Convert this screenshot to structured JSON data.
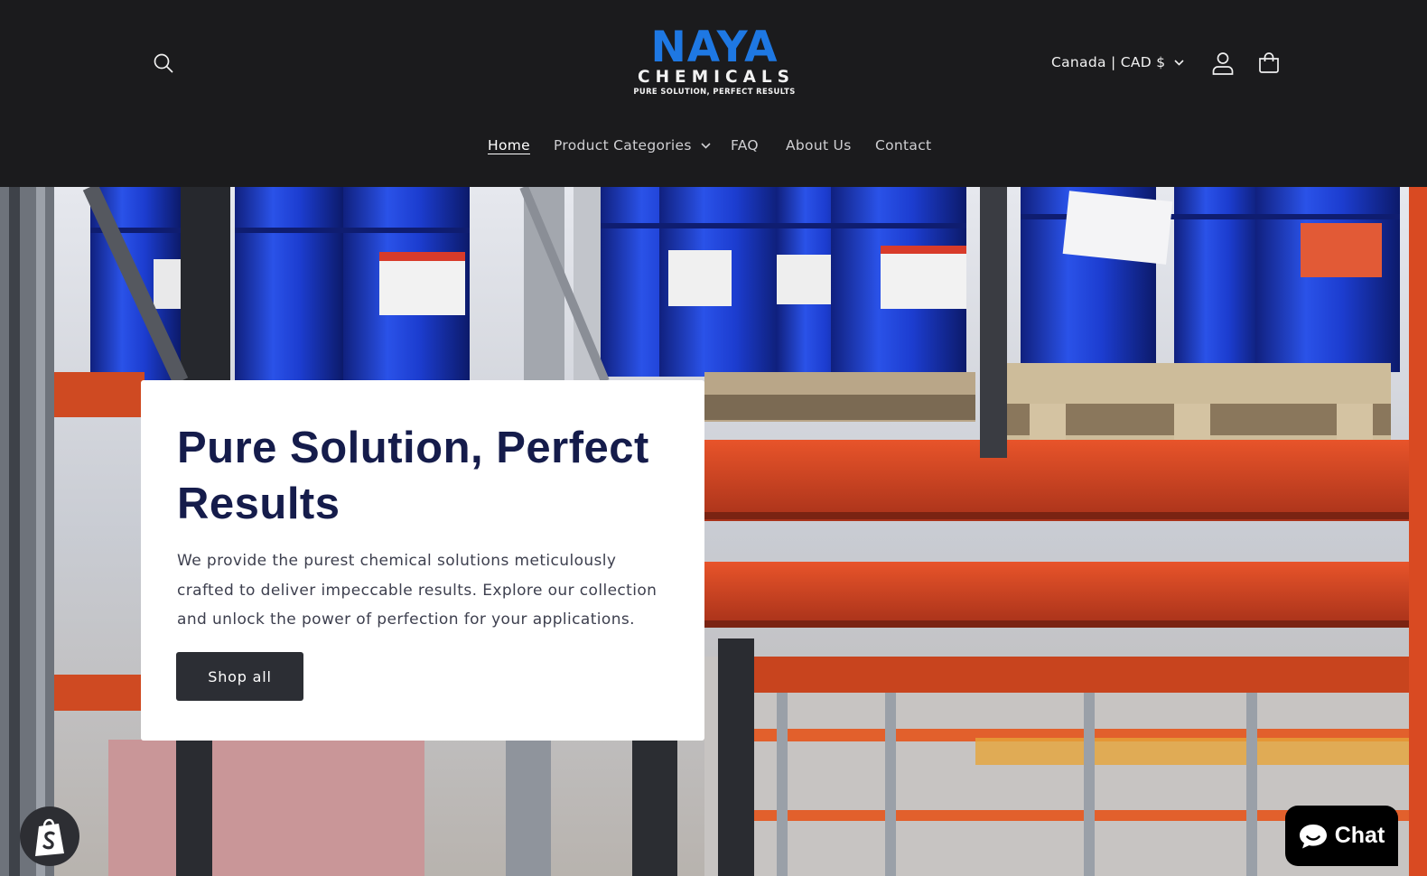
{
  "header": {
    "logo": {
      "line1": "NAYA",
      "line2": "CHEMICALS",
      "tagline": "PURE SOLUTION, PERFECT RESULTS"
    },
    "currency_label": "Canada | CAD $",
    "icons": {
      "search": "search-icon",
      "account": "user-icon",
      "cart": "cart-icon",
      "dropdown": "chevron-down-icon"
    }
  },
  "nav": {
    "items": [
      {
        "label": "Home",
        "active": true
      },
      {
        "label": "Product Categories",
        "has_dropdown": true
      },
      {
        "label": "FAQ"
      },
      {
        "label": "About Us"
      },
      {
        "label": "Contact"
      }
    ]
  },
  "hero": {
    "title": "Pure Solution, Perfect Results",
    "description": "We provide the purest chemical solutions meticulously crafted to deliver impeccable results. Explore our collection and unlock the power of perfection for your applications.",
    "cta_label": "Shop all"
  },
  "widgets": {
    "chat_label": "Chat",
    "shopify_icon": "shopify-bag-icon"
  },
  "colors": {
    "header_bg": "#1b1b1d",
    "logo_blue": "#1e78e3",
    "title_navy": "#151c4b",
    "button_dark": "#2c2e34",
    "drum_blue": "#1d3fd1",
    "rack_orange": "#d4451d"
  }
}
